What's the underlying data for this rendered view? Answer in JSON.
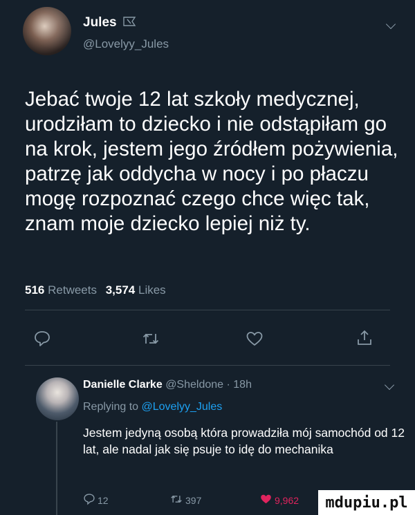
{
  "tweet": {
    "author_name": "Jules",
    "author_handle": "@Lovelyy_Jules",
    "text": "Jebać twoje 12 lat szkoły medycznej, urodziłam to dziecko i nie odstąpiłam go na krok, jestem jego źródłem pożywienia, patrzę jak oddycha w nocy i po płaczu mogę rozpoznać czego chce więc tak, znam moje dziecko lepiej niż ty.",
    "retweets_count": "516",
    "retweets_label": "Retweets",
    "likes_count": "3,574",
    "likes_label": "Likes"
  },
  "actions": {
    "reply_icon": "reply-icon",
    "retweet_icon": "retweet-icon",
    "like_icon": "heart-icon",
    "share_icon": "share-icon"
  },
  "reply": {
    "author_name": "Danielle Clarke",
    "author_handle": "@Sheldone",
    "time": "18h",
    "replying_prefix": "Replying to",
    "replying_handle": "@Lovelyy_Jules",
    "text": "Jestem jedyną osobą która prowadziła mój samochód od 12 lat, ale nadal jak się psuje to idę do mechanika",
    "reply_count": "12",
    "retweet_count": "397",
    "like_count": "9,962"
  },
  "watermark": "mdupiu.pl",
  "colors": {
    "background": "#15202b",
    "muted": "#8899a6",
    "link": "#1da1f2",
    "like": "#e0245e",
    "divider": "#38444d"
  }
}
